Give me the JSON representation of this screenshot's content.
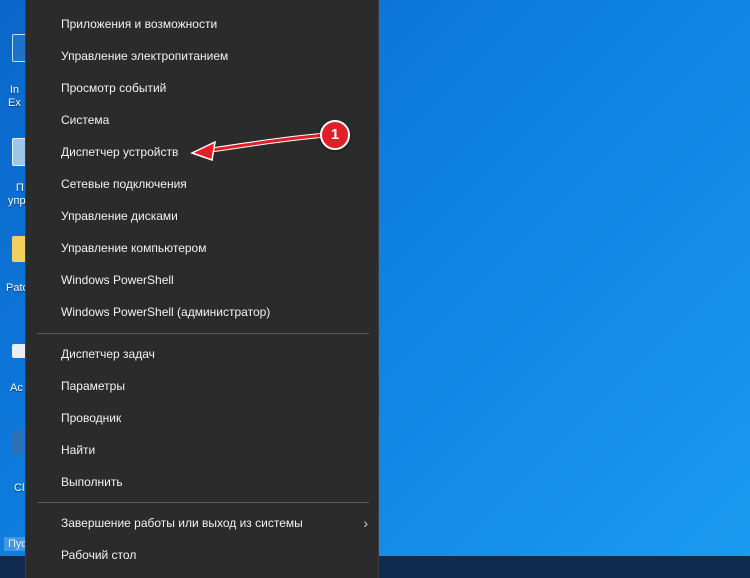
{
  "desktop": {
    "icons": [
      {
        "label": "In\nEx",
        "icon": "internet-explorer-icon"
      },
      {
        "label": "П\nупра",
        "icon": "control-panel-icon"
      },
      {
        "label": "Pato",
        "icon": "folder-icon"
      },
      {
        "label": "Ac",
        "icon": "shortcut-icon"
      },
      {
        "label": "Cl",
        "icon": "shortcut-icon"
      }
    ]
  },
  "taskbar": {
    "start_hint": "Пуск"
  },
  "menu": {
    "group1": [
      "Приложения и возможности",
      "Управление электропитанием",
      "Просмотр событий",
      "Система",
      "Диспетчер устройств",
      "Сетевые подключения",
      "Управление дисками",
      "Управление компьютером",
      "Windows PowerShell",
      "Windows PowerShell (администратор)"
    ],
    "group2": [
      "Диспетчер задач",
      "Параметры",
      "Проводник",
      "Найти",
      "Выполнить"
    ],
    "group3": [
      "Завершение работы или выход из системы",
      "Рабочий стол"
    ],
    "submenu_glyph": "›"
  },
  "annotation": {
    "number": "1",
    "color": "#e21f26"
  }
}
